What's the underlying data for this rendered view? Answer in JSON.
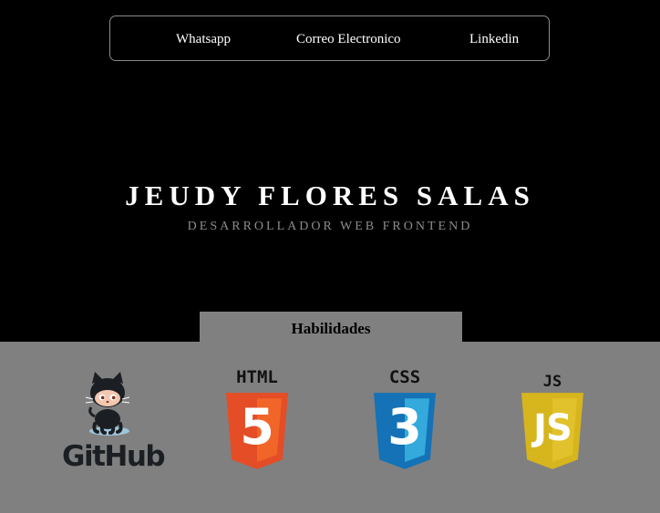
{
  "nav": {
    "items": [
      {
        "label": "Whatsapp"
      },
      {
        "label": "Correo Electronico"
      },
      {
        "label": "Linkedin"
      }
    ]
  },
  "hero": {
    "title": "JEUDY FLORES SALAS",
    "subtitle": "DESARROLLADOR WEB FRONTEND"
  },
  "skills": {
    "heading": "Habilidades",
    "logos": [
      {
        "name": "github-logo",
        "text": "GitHub"
      },
      {
        "name": "html5-logo",
        "text": "HTML",
        "number": "5"
      },
      {
        "name": "css3-logo",
        "text": "CSS",
        "number": "3"
      },
      {
        "name": "js-logo",
        "text": "JS"
      }
    ]
  },
  "colors": {
    "page_background": "#000000",
    "skills_background": "#808080",
    "html_orange": "#e44d26",
    "css_blue": "#1572b6",
    "js_yellow": "#d6b51d"
  }
}
